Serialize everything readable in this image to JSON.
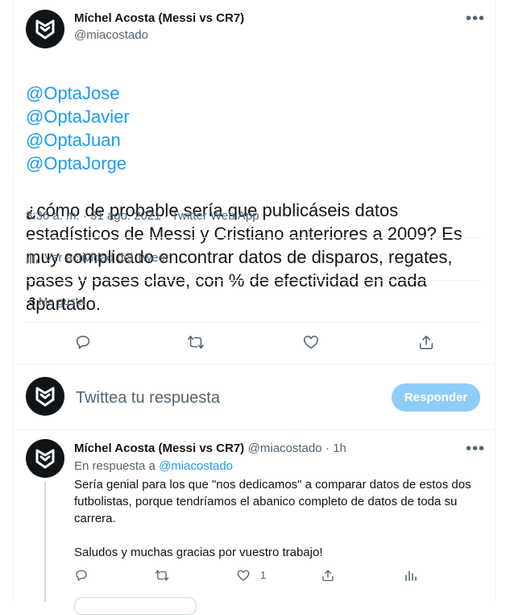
{
  "tweet": {
    "author_name": "Míchel Acosta (Messi vs CR7)",
    "author_handle": "@miacostado",
    "mentions": [
      "@OptaJose",
      "@OptaJavier",
      "@OptaJuan",
      "@OptaJorge"
    ],
    "body": "¿cómo de probable sería que publicáseis datos estadísticos de Messi y Cristiano anteriores a 2009? Es muy complicado encontrar datos de disparos, regates, pases y pases clave, con % de efectividad en cada apartado.",
    "timestamp": "8:36 a. m. · 31 ago. 2021 · Twitter Web App",
    "view_activity": "Ver actividad del Tweet",
    "likes_count": "3",
    "likes_label": "Me gusta"
  },
  "composer": {
    "placeholder": "Twittea tu respuesta",
    "reply_button": "Responder"
  },
  "reply": {
    "author_name": "Míchel Acosta (Messi vs CR7)",
    "author_handle": "@miacostado",
    "time": "· 1h",
    "replying_prefix": "En respuesta a",
    "replying_to": "@miacostado",
    "body": "Sería genial para los que \"nos dedicamos\" a comparar datos de estos dos futbolistas, porque tendríamos el abanico completo de datos de toda su carrera.\n\nSaludos y muchas gracias por vuestro trabajo!",
    "like_count": "1"
  },
  "icons": [
    "avatar-logo-icon",
    "more-icon",
    "analytics-icon",
    "reply-icon",
    "retweet-icon",
    "like-icon",
    "share-icon"
  ],
  "colors": {
    "accent": "#1d9bf0",
    "button_disabled": "#8ecdf8",
    "text": "#0f1419",
    "muted": "#536471"
  }
}
